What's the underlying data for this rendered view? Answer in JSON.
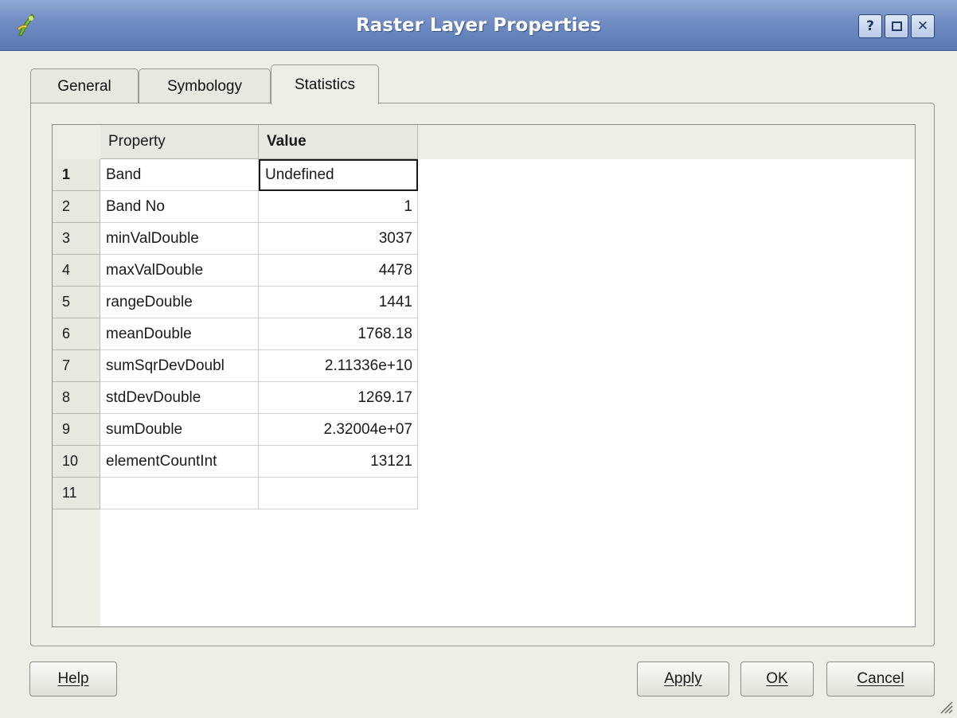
{
  "window": {
    "title": "Raster Layer Properties",
    "help_glyph": "?",
    "close_glyph": "✕"
  },
  "tabs": [
    {
      "label": "General"
    },
    {
      "label": "Symbology"
    },
    {
      "label": "Statistics",
      "selected": true
    }
  ],
  "table": {
    "columns": [
      "Property",
      "Value"
    ],
    "rows": [
      {
        "num": "1",
        "property": "Band",
        "value": "Undefined"
      },
      {
        "num": "2",
        "property": "Band No",
        "value": "1"
      },
      {
        "num": "3",
        "property": "minValDouble",
        "value": "3037"
      },
      {
        "num": "4",
        "property": "maxValDouble",
        "value": "4478"
      },
      {
        "num": "5",
        "property": "rangeDouble",
        "value": "1441"
      },
      {
        "num": "6",
        "property": "meanDouble",
        "value": "1768.18"
      },
      {
        "num": "7",
        "property": "sumSqrDevDoubl",
        "value": "2.11336e+10"
      },
      {
        "num": "8",
        "property": "stdDevDouble",
        "value": "1269.17"
      },
      {
        "num": "9",
        "property": "sumDouble",
        "value": "2.32004e+07"
      },
      {
        "num": "10",
        "property": "elementCountInt",
        "value": "13121"
      },
      {
        "num": "11",
        "property": "",
        "value": ""
      }
    ]
  },
  "buttons": {
    "help": "Help",
    "apply": "Apply",
    "ok": "OK",
    "cancel": "Cancel"
  },
  "colors": {
    "titlebar": "#6f8cc3",
    "window_bg": "#eeede6",
    "header_bg": "#e8e7e0"
  }
}
